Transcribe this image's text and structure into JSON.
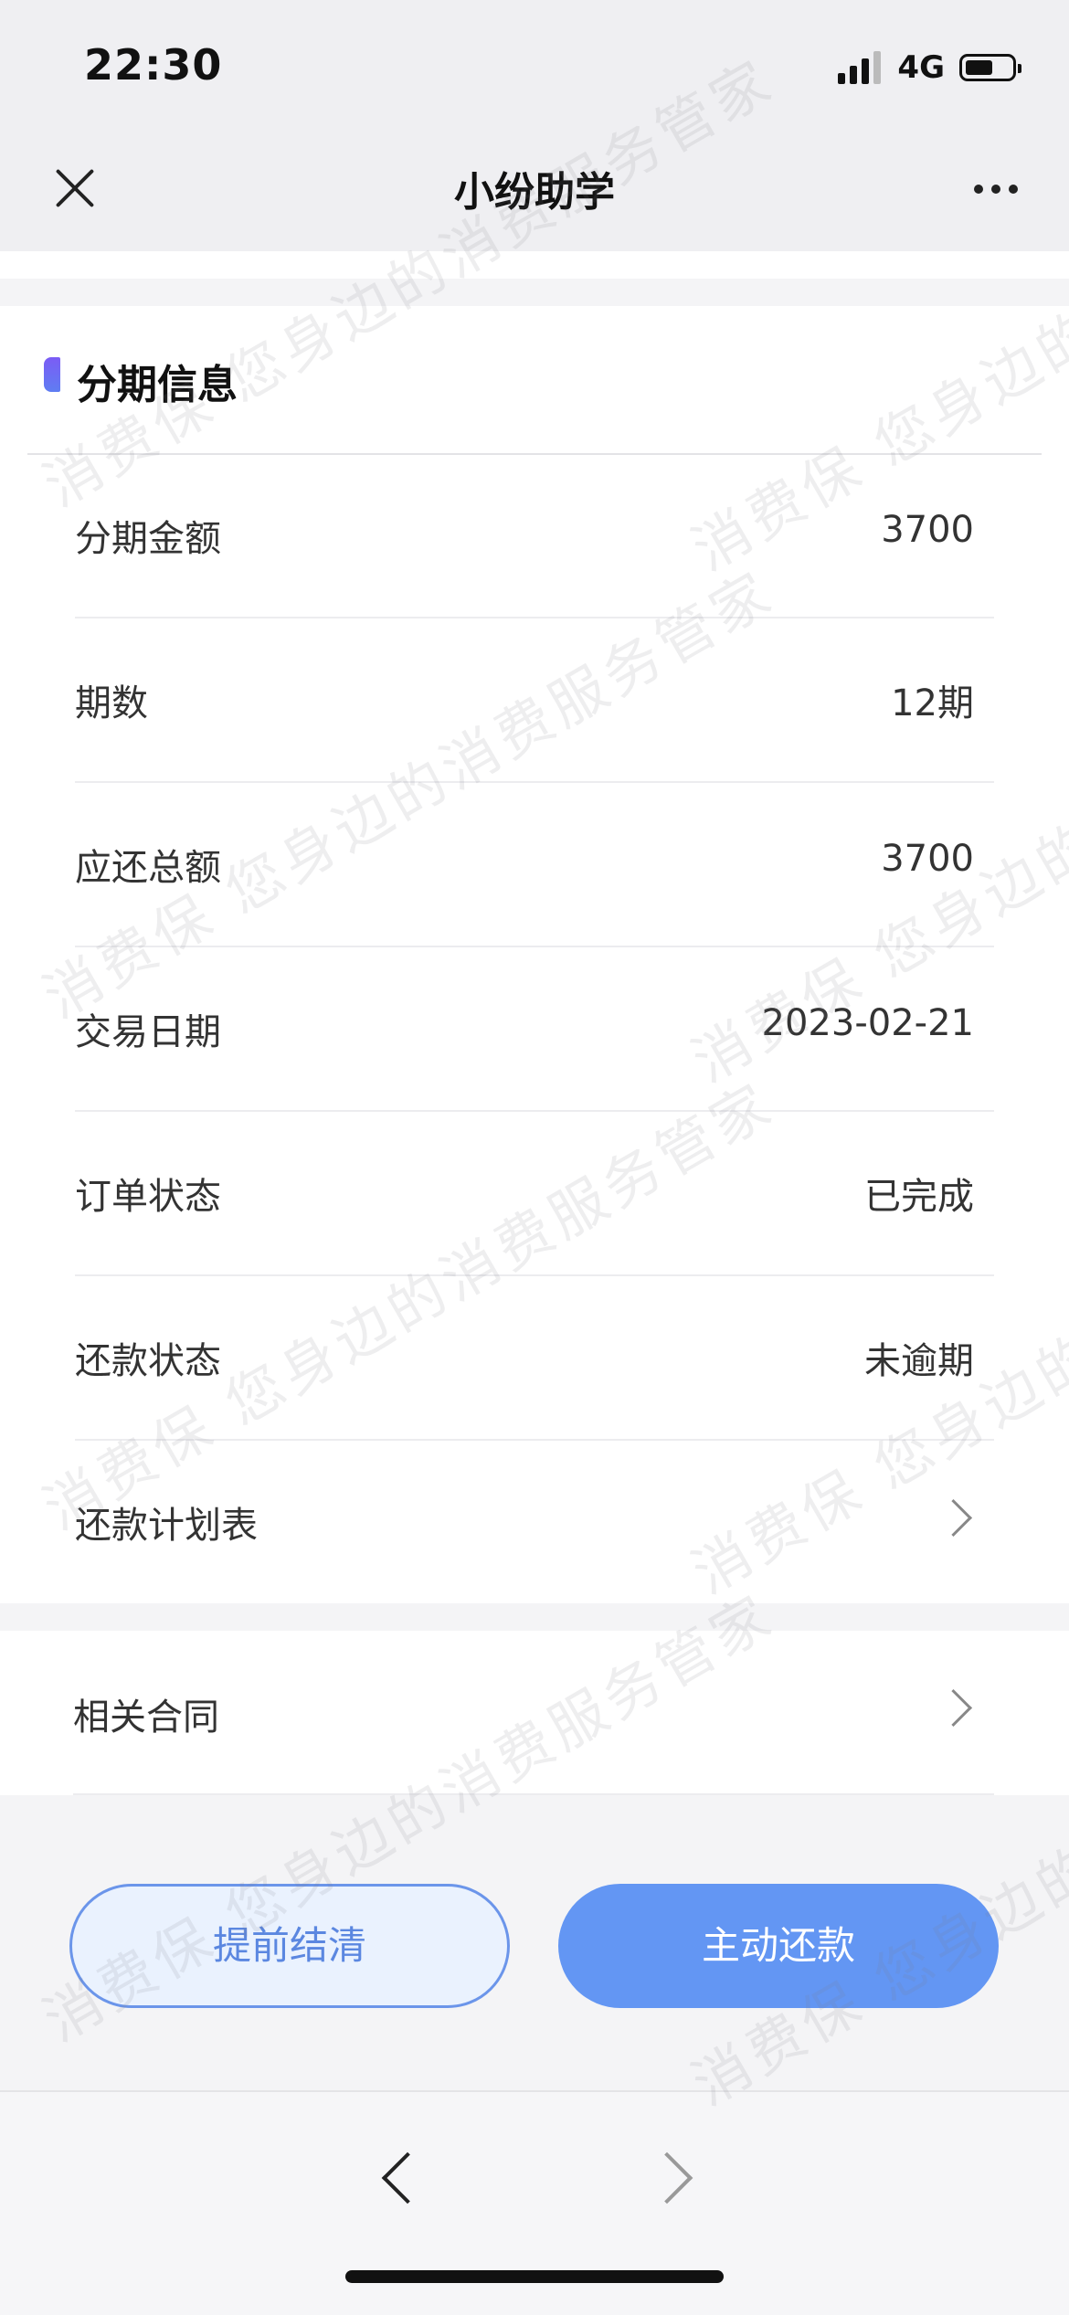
{
  "status_bar": {
    "time": "22:30",
    "network": "4G",
    "battery_level_percent": 60
  },
  "nav": {
    "title": "小纷助学"
  },
  "section": {
    "title": "分期信息"
  },
  "rows": [
    {
      "label": "分期金额",
      "value": "3700"
    },
    {
      "label": "期数",
      "value": "12期"
    },
    {
      "label": "应还总额",
      "value": "3700"
    },
    {
      "label": "交易日期",
      "value": "2023-02-21"
    },
    {
      "label": "订单状态",
      "value": "已完成"
    },
    {
      "label": "还款状态",
      "value": "未逾期"
    }
  ],
  "links": {
    "repayment_plan": "还款计划表",
    "contracts": "相关合同"
  },
  "buttons": {
    "prepay": "提前结清",
    "repay": "主动还款"
  },
  "watermark": "消费保 您身边的消费服务管家",
  "colors": {
    "accent": "#6396f3",
    "prepay_bg": "#eaf2fe",
    "section_mark": "#7b5cf5"
  }
}
